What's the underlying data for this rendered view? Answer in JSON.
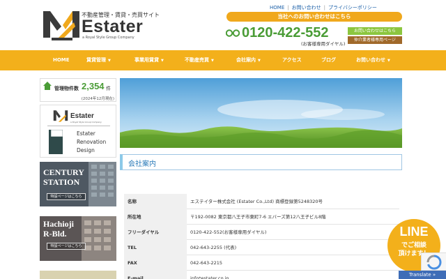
{
  "header": {
    "tagline": "不動産管理・賃貸・売買サイト",
    "brand": "Estater",
    "brand_sub": "a Royal Style Group Company",
    "toplinks": [
      "HOME",
      "お問い合わせ",
      "プライバシーポリシー"
    ],
    "contact_banner": "当社へのお問い合わせはこちら",
    "phone": "0120-422-552",
    "phone_note": "(お客様専用ダイヤル)",
    "contact_button": "お問い合わせはこちら",
    "vendor_button": "仲介業者様専用ページ"
  },
  "nav": [
    {
      "label": "HOME",
      "caret": false
    },
    {
      "label": "賃貸管理",
      "caret": true
    },
    {
      "label": "事業用賃貸",
      "caret": true
    },
    {
      "label": "不動産売買",
      "caret": true
    },
    {
      "label": "会社案内",
      "caret": true
    },
    {
      "label": "アクセス",
      "caret": false
    },
    {
      "label": "ブログ",
      "caret": false
    },
    {
      "label": "お問い合わせ",
      "caret": true
    }
  ],
  "sidebar": {
    "count_label": "管理物件数",
    "count_value": "2,354",
    "count_unit": "件",
    "count_date": "(2024年12月現在)",
    "banner1_name": "Estater",
    "banner1_small": "a Royal Style Group Company",
    "banner1_lines": [
      "Estater",
      "Renovation",
      "Design"
    ],
    "banner2_title": [
      "CENTURY",
      "STATION"
    ],
    "banner2_button": "特設ページはこちら",
    "banner3_title": [
      "Hachioji",
      "R-Bld."
    ],
    "banner3_button": "特設ページはこちら"
  },
  "main": {
    "section_title": "会社案内",
    "rows": [
      {
        "label": "名称",
        "value": "エステイター株式会社 (Estater Co.,Ltd) 商標登録第5248320号"
      },
      {
        "label": "所在地",
        "value": "〒192-0082 東京都八王子市東町7-6 エバーズ第12八王子ビル8階"
      },
      {
        "label": "フリーダイヤル",
        "value": "0120-422-552(お客様専用ダイヤル)"
      },
      {
        "label": "TEL",
        "value": "042-643-2255 (代表)"
      },
      {
        "label": "FAX",
        "value": "042-643-2215"
      },
      {
        "label": "E-mail",
        "value": "info*estater.co.jp"
      }
    ]
  },
  "widgets": {
    "line_big": "LINE",
    "line_small_1": "でご相談",
    "line_small_2": "頂けます！",
    "translate": "Translate »"
  },
  "colors": {
    "accent": "#f3b01b",
    "green": "#4a9c36",
    "link": "#1a5fa8",
    "brown": "#a0692a"
  }
}
